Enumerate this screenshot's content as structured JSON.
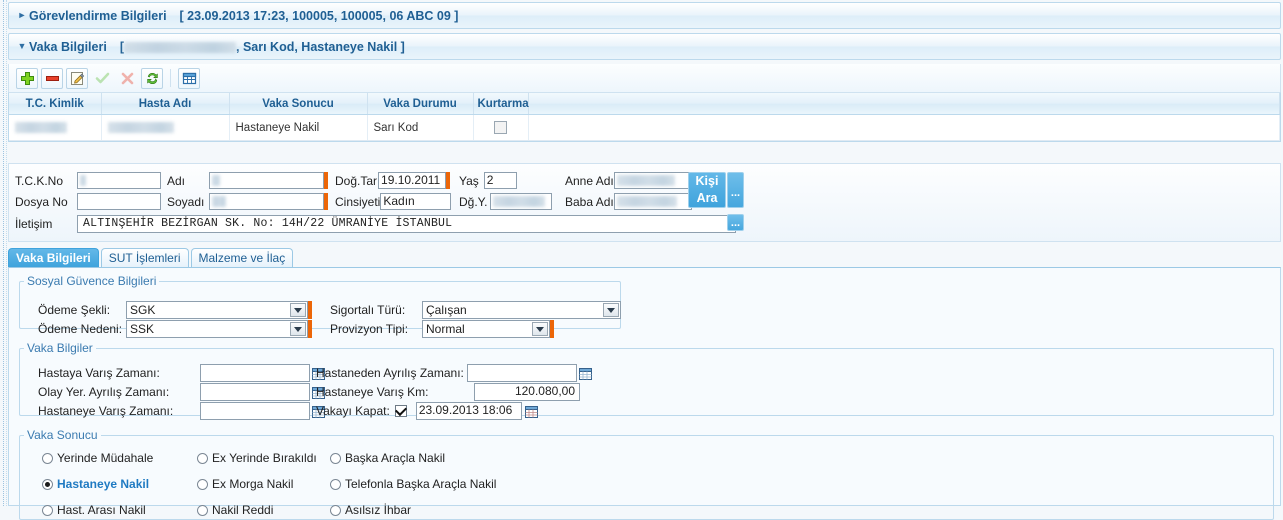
{
  "colors": {
    "accent": "#3fa3dc",
    "header_text": "#1f5f93",
    "required_marker": "#ec6608",
    "selected_radio_text": "#1f7ac2",
    "panel_bg": "#f7fbfe"
  },
  "header": {
    "assignment": {
      "title": "Görevlendirme Bilgileri",
      "meta": "[ 23.09.2013 17:23, 100005, 100005, 06 ABC 09 ]",
      "collapsed": true
    },
    "case": {
      "title": "Vaka Bilgileri",
      "meta_prefix": "[",
      "meta_suffix": ", Sarı Kod, Hastaneye Nakil ]",
      "collapsed": false
    }
  },
  "toolbar": {
    "buttons": [
      {
        "name": "add",
        "icon": "plus-icon",
        "enabled": true
      },
      {
        "name": "delete",
        "icon": "minus-icon",
        "enabled": true
      },
      {
        "name": "edit",
        "icon": "pencil-icon",
        "enabled": true
      },
      {
        "name": "confirm",
        "icon": "check-icon",
        "enabled": false
      },
      {
        "name": "cancel",
        "icon": "x-icon",
        "enabled": false
      },
      {
        "name": "refresh",
        "icon": "refresh-icon",
        "enabled": true
      },
      {
        "name": "grid-view",
        "icon": "table-icon",
        "enabled": true
      }
    ]
  },
  "grid": {
    "columns": [
      "T.C. Kimlik",
      "Hasta Adı",
      "Vaka Sonucu",
      "Vaka Durumu",
      "Kurtarma",
      ""
    ],
    "rows": [
      {
        "tc_kimlik": "",
        "hasta_adi": "",
        "vaka_sonucu": "Hastaneye Nakil",
        "vaka_durumu": "Sarı Kod",
        "kurtarma_checked": false
      }
    ]
  },
  "patient": {
    "tckno": {
      "label": "T.C.K.No",
      "value": "",
      "placeholder": ""
    },
    "dosyano": {
      "label": "Dosya No",
      "value": "",
      "placeholder": ""
    },
    "adi": {
      "label": "Adı",
      "value": "",
      "placeholder": ""
    },
    "soyadi": {
      "label": "Soyadı",
      "value": "",
      "placeholder": ""
    },
    "dogtar": {
      "label": "Doğ.Tar",
      "value": "19.10.2011",
      "required": true
    },
    "cinsiyet": {
      "label": "Cinsiyeti",
      "value": "Kadın"
    },
    "yas": {
      "label": "Yaş",
      "value": "2"
    },
    "dgy": {
      "label": "Dğ.Y.",
      "value": ""
    },
    "anne_adi": {
      "label": "Anne Adı",
      "value": ""
    },
    "baba_adi": {
      "label": "Baba Adı",
      "value": ""
    },
    "iletisim": {
      "label": "İletişim",
      "value": "ALTINŞEHİR BEZİRGAN SK. No: 14H/22   ÜMRANİYE İSTANBUL"
    },
    "kisi_ara_button": {
      "line1": "Kişi",
      "line2": "Ara"
    },
    "ellipsis_label": "..."
  },
  "tabs": [
    {
      "label": "Vaka Bilgileri",
      "active": true
    },
    {
      "label": "SUT İşlemleri",
      "active": false
    },
    {
      "label": "Malzeme ve İlaç",
      "active": false
    }
  ],
  "social_security": {
    "legend": "Sosyal Güvence Bilgileri",
    "odeme_sekli": {
      "label": "Ödeme Şekli:",
      "value": "SGK"
    },
    "odeme_nedeni": {
      "label": "Ödeme Nedeni:",
      "value": "SSK"
    },
    "sigortali_turu": {
      "label": "Sigortalı Türü:",
      "value": "Çalışan"
    },
    "provizyon_tipi": {
      "label": "Provizyon Tipi:",
      "value": "Normal"
    }
  },
  "case_info": {
    "legend": "Vaka Bilgiler",
    "hastaya_varis": {
      "label": "Hastaya Varış Zamanı:",
      "value": ""
    },
    "olay_yer_ayrilis": {
      "label": "Olay Yer. Ayrılış Zamanı:",
      "value": ""
    },
    "hastaneye_varis": {
      "label": "Hastaneye Varış Zamanı:",
      "value": ""
    },
    "hastaneden_ayrilis": {
      "label": "Hastaneden Ayrılış Zamanı:",
      "value": ""
    },
    "hastaneye_varis_km": {
      "label": "Hastaneye Varış Km:",
      "value": "120.080,00"
    },
    "vakayi_kapat": {
      "label": "Vakayı Kapat:",
      "checked": true,
      "value": "23.09.2013 18:06"
    }
  },
  "case_result": {
    "legend": "Vaka Sonucu",
    "options": [
      {
        "label": "Yerinde Müdahale",
        "selected": false,
        "col": 0,
        "row": 0
      },
      {
        "label": "Hastaneye Nakil",
        "selected": true,
        "col": 0,
        "row": 1
      },
      {
        "label": "Hast. Arası Nakil",
        "selected": false,
        "col": 0,
        "row": 2
      },
      {
        "label": "Ex Yerinde Bırakıldı",
        "selected": false,
        "col": 1,
        "row": 0
      },
      {
        "label": "Ex Morga Nakil",
        "selected": false,
        "col": 1,
        "row": 1
      },
      {
        "label": "Nakil Reddi",
        "selected": false,
        "col": 1,
        "row": 2
      },
      {
        "label": "Başka Araçla Nakil",
        "selected": false,
        "col": 2,
        "row": 0
      },
      {
        "label": "Telefonla Başka Araçla Nakil",
        "selected": false,
        "col": 2,
        "row": 1
      },
      {
        "label": "Asılsız İhbar",
        "selected": false,
        "col": 2,
        "row": 2
      }
    ]
  }
}
